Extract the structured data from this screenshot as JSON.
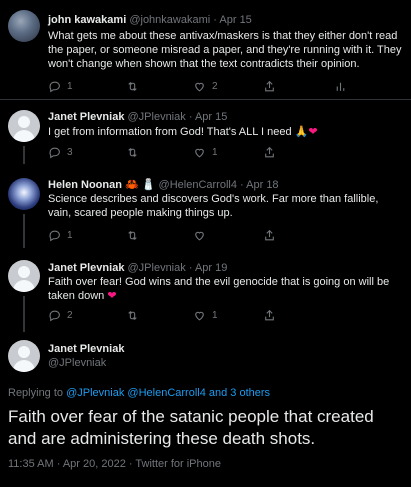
{
  "tweets": [
    {
      "name": "john kawakami",
      "handle": "@johnkawakami",
      "sep": "·",
      "date": "Apr 15",
      "text": "What gets me about these antivax/maskers is that they either don't read the paper, or someone misread a paper, and they're running with it.  They won't change when shown that the text contradicts their opinion.",
      "reply_count": "1",
      "retweet_count": "",
      "like_count": "2"
    },
    {
      "name": "Janet Plevniak",
      "handle": "@JPlevniak",
      "sep": "·",
      "date": "Apr 15",
      "text": "I get from information from God!  That's ALL I need ",
      "emoji": "🙏❤",
      "reply_count": "3",
      "retweet_count": "",
      "like_count": "1"
    },
    {
      "name": "Helen Noonan",
      "name_emoji": "🦀 🧂",
      "handle": "@HelenCarroll4",
      "sep": "·",
      "date": "Apr 18",
      "text": "Science describes and discovers God's work. Far more than fallible, vain, scared people making things up.",
      "reply_count": "1",
      "retweet_count": "",
      "like_count": ""
    },
    {
      "name": "Janet Plevniak",
      "handle": "@JPlevniak",
      "sep": "·",
      "date": "Apr 19",
      "text": "Faith over fear!  God wins and the evil genocide that is going on will be taken down ",
      "emoji": "❤",
      "reply_count": "2",
      "retweet_count": "",
      "like_count": "1"
    }
  ],
  "main": {
    "name": "Janet Plevniak",
    "handle": "@JPlevniak",
    "replying_prefix": "Replying to",
    "replying_to": "@JPlevniak @HelenCarroll4 and 3 others",
    "text": "Faith over fear of the satanic people that created and are administering these death shots.",
    "timestamp": "11:35 AM · Apr 20, 2022 · Twitter for iPhone"
  },
  "colors": {
    "background": "#000000",
    "text": "#e7e9ea",
    "muted": "#71767b",
    "link": "#1d9bf0",
    "like": "#f91880"
  }
}
